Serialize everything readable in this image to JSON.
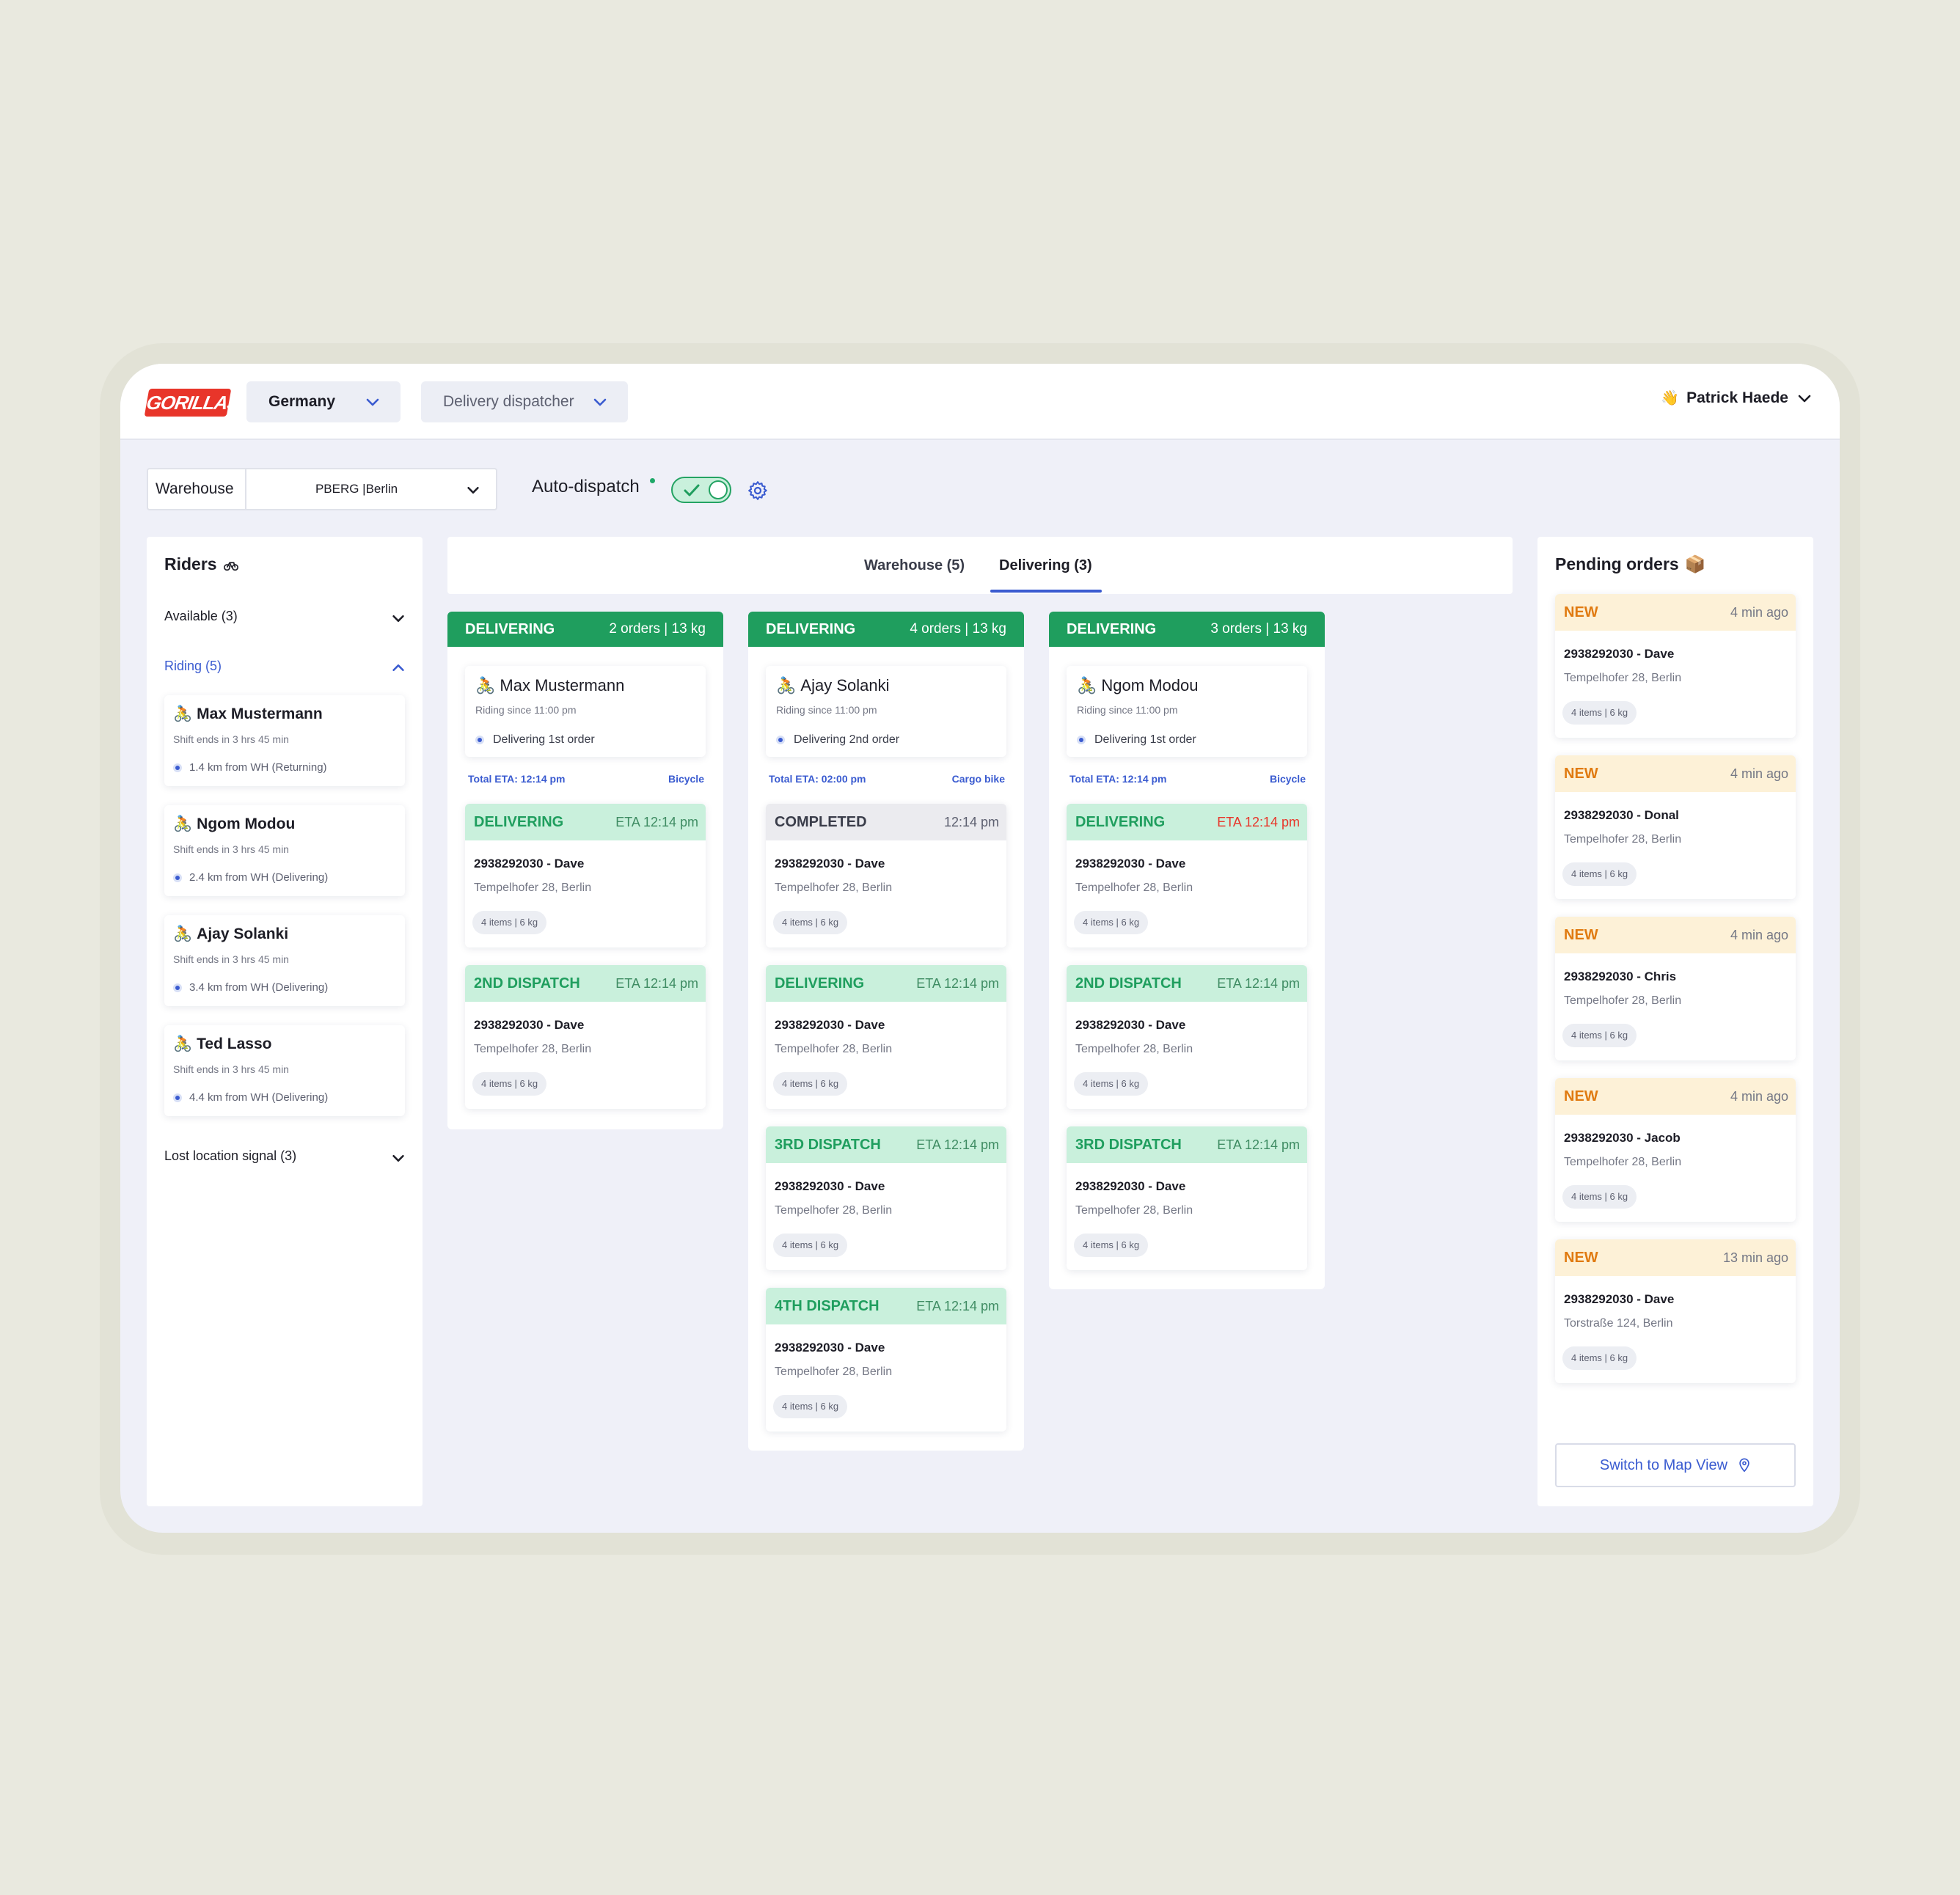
{
  "header": {
    "logo_text": "GORILLAS",
    "country": "Germany",
    "role": "Delivery dispatcher",
    "user_emoji": "👋",
    "user_name": "Patrick Haede"
  },
  "toolbar": {
    "warehouse_label": "Warehouse",
    "warehouse_value": "PBERG |Berlin",
    "auto_dispatch_label": "Auto-dispatch",
    "auto_dispatch_on": true
  },
  "riders": {
    "title": "Riders",
    "available_label": "Available (3)",
    "riding_label": "Riding (5)",
    "lost_label": "Lost location signal (3)",
    "list": [
      {
        "name": "Max Mustermann",
        "shift": "Shift ends in 3 hrs 45 min",
        "location": "1.4 km from WH (Returning)"
      },
      {
        "name": "Ngom Modou",
        "shift": "Shift ends in 3 hrs 45 min",
        "location": "2.4 km from WH (Delivering)"
      },
      {
        "name": "Ajay Solanki",
        "shift": "Shift ends in 3 hrs 45 min",
        "location": "3.4 km from WH (Delivering)"
      },
      {
        "name": "Ted Lasso",
        "shift": "Shift ends in 3 hrs 45 min",
        "location": "4.4 km from WH (Delivering)"
      }
    ]
  },
  "tabs": [
    {
      "label": "Warehouse (5)"
    },
    {
      "label": "Delivering (3)"
    }
  ],
  "columns": [
    {
      "status": "DELIVERING",
      "summary": "2 orders | 13 kg",
      "rider": "Max Mustermann",
      "since": "Riding since 11:00 pm",
      "progress": "Delivering 1st order",
      "eta": "Total ETA: 12:14 pm",
      "vehicle": "Bicycle",
      "orders": [
        {
          "status": "DELIVERING",
          "eta": "ETA 12:14 pm",
          "id": "2938292030 - Dave",
          "address": "Tempelhofer 28, Berlin",
          "items": "4 items | 6 kg"
        },
        {
          "status": "2ND DISPATCH",
          "eta": "ETA 12:14 pm",
          "id": "2938292030 - Dave",
          "address": "Tempelhofer 28, Berlin",
          "items": "4 items | 6 kg"
        }
      ]
    },
    {
      "status": "DELIVERING",
      "summary": "4 orders | 13 kg",
      "rider": "Ajay Solanki",
      "since": "Riding since 11:00 pm",
      "progress": "Delivering 2nd order",
      "eta": "Total ETA: 02:00 pm",
      "vehicle": "Cargo bike",
      "orders": [
        {
          "status": "COMPLETED",
          "eta": "12:14 pm",
          "id": "2938292030 - Dave",
          "address": "Tempelhofer 28, Berlin",
          "items": "4 items | 6 kg"
        },
        {
          "status": "DELIVERING",
          "eta": "ETA 12:14 pm",
          "id": "2938292030 - Dave",
          "address": "Tempelhofer 28, Berlin",
          "items": "4 items | 6 kg"
        },
        {
          "status": "3RD DISPATCH",
          "eta": "ETA 12:14 pm",
          "id": "2938292030 - Dave",
          "address": "Tempelhofer 28, Berlin",
          "items": "4 items | 6 kg"
        },
        {
          "status": "4TH DISPATCH",
          "eta": "ETA 12:14 pm",
          "id": "2938292030 - Dave",
          "address": "Tempelhofer 28, Berlin",
          "items": "4 items | 6 kg"
        }
      ]
    },
    {
      "status": "DELIVERING",
      "summary": "3 orders | 13 kg",
      "rider": "Ngom Modou",
      "since": "Riding since 11:00 pm",
      "progress": "Delivering 1st order",
      "eta": "Total ETA: 12:14 pm",
      "vehicle": "Bicycle",
      "orders": [
        {
          "status": "DELIVERING",
          "eta": "ETA 12:14 pm",
          "id": "2938292030 - Dave",
          "address": "Tempelhofer 28, Berlin",
          "items": "4 items | 6 kg"
        },
        {
          "status": "2ND DISPATCH",
          "eta": "ETA 12:14 pm",
          "id": "2938292030 - Dave",
          "address": "Tempelhofer 28, Berlin",
          "items": "4 items | 6 kg"
        },
        {
          "status": "3RD DISPATCH",
          "eta": "ETA 12:14 pm",
          "id": "2938292030 - Dave",
          "address": "Tempelhofer 28, Berlin",
          "items": "4 items | 6 kg"
        }
      ]
    }
  ],
  "pending": {
    "title": "Pending orders",
    "title_emoji": "📦",
    "orders": [
      {
        "status": "NEW",
        "ago": "4 min ago",
        "id": "2938292030 - Dave",
        "address": "Tempelhofer 28, Berlin",
        "items": "4 items | 6 kg"
      },
      {
        "status": "NEW",
        "ago": "4 min ago",
        "id": "2938292030 - Donal",
        "address": "Tempelhofer 28, Berlin",
        "items": "4 items | 6 kg"
      },
      {
        "status": "NEW",
        "ago": "4 min ago",
        "id": "2938292030 - Chris",
        "address": "Tempelhofer 28, Berlin",
        "items": "4 items | 6 kg"
      },
      {
        "status": "NEW",
        "ago": "4 min ago",
        "id": "2938292030 - Jacob",
        "address": "Tempelhofer 28, Berlin",
        "items": "4 items | 6 kg"
      },
      {
        "status": "NEW",
        "ago": "13 min ago",
        "id": "2938292030 - Dave",
        "address": "Torstraße 124, Berlin",
        "items": "4 items | 6 kg"
      }
    ],
    "map_button": "Switch to Map View"
  },
  "colors": {
    "accent_blue": "#3a5bd0",
    "delivering_green": "#1f9e5e",
    "new_orange": "#e07a10",
    "late_red": "#e8352a"
  }
}
